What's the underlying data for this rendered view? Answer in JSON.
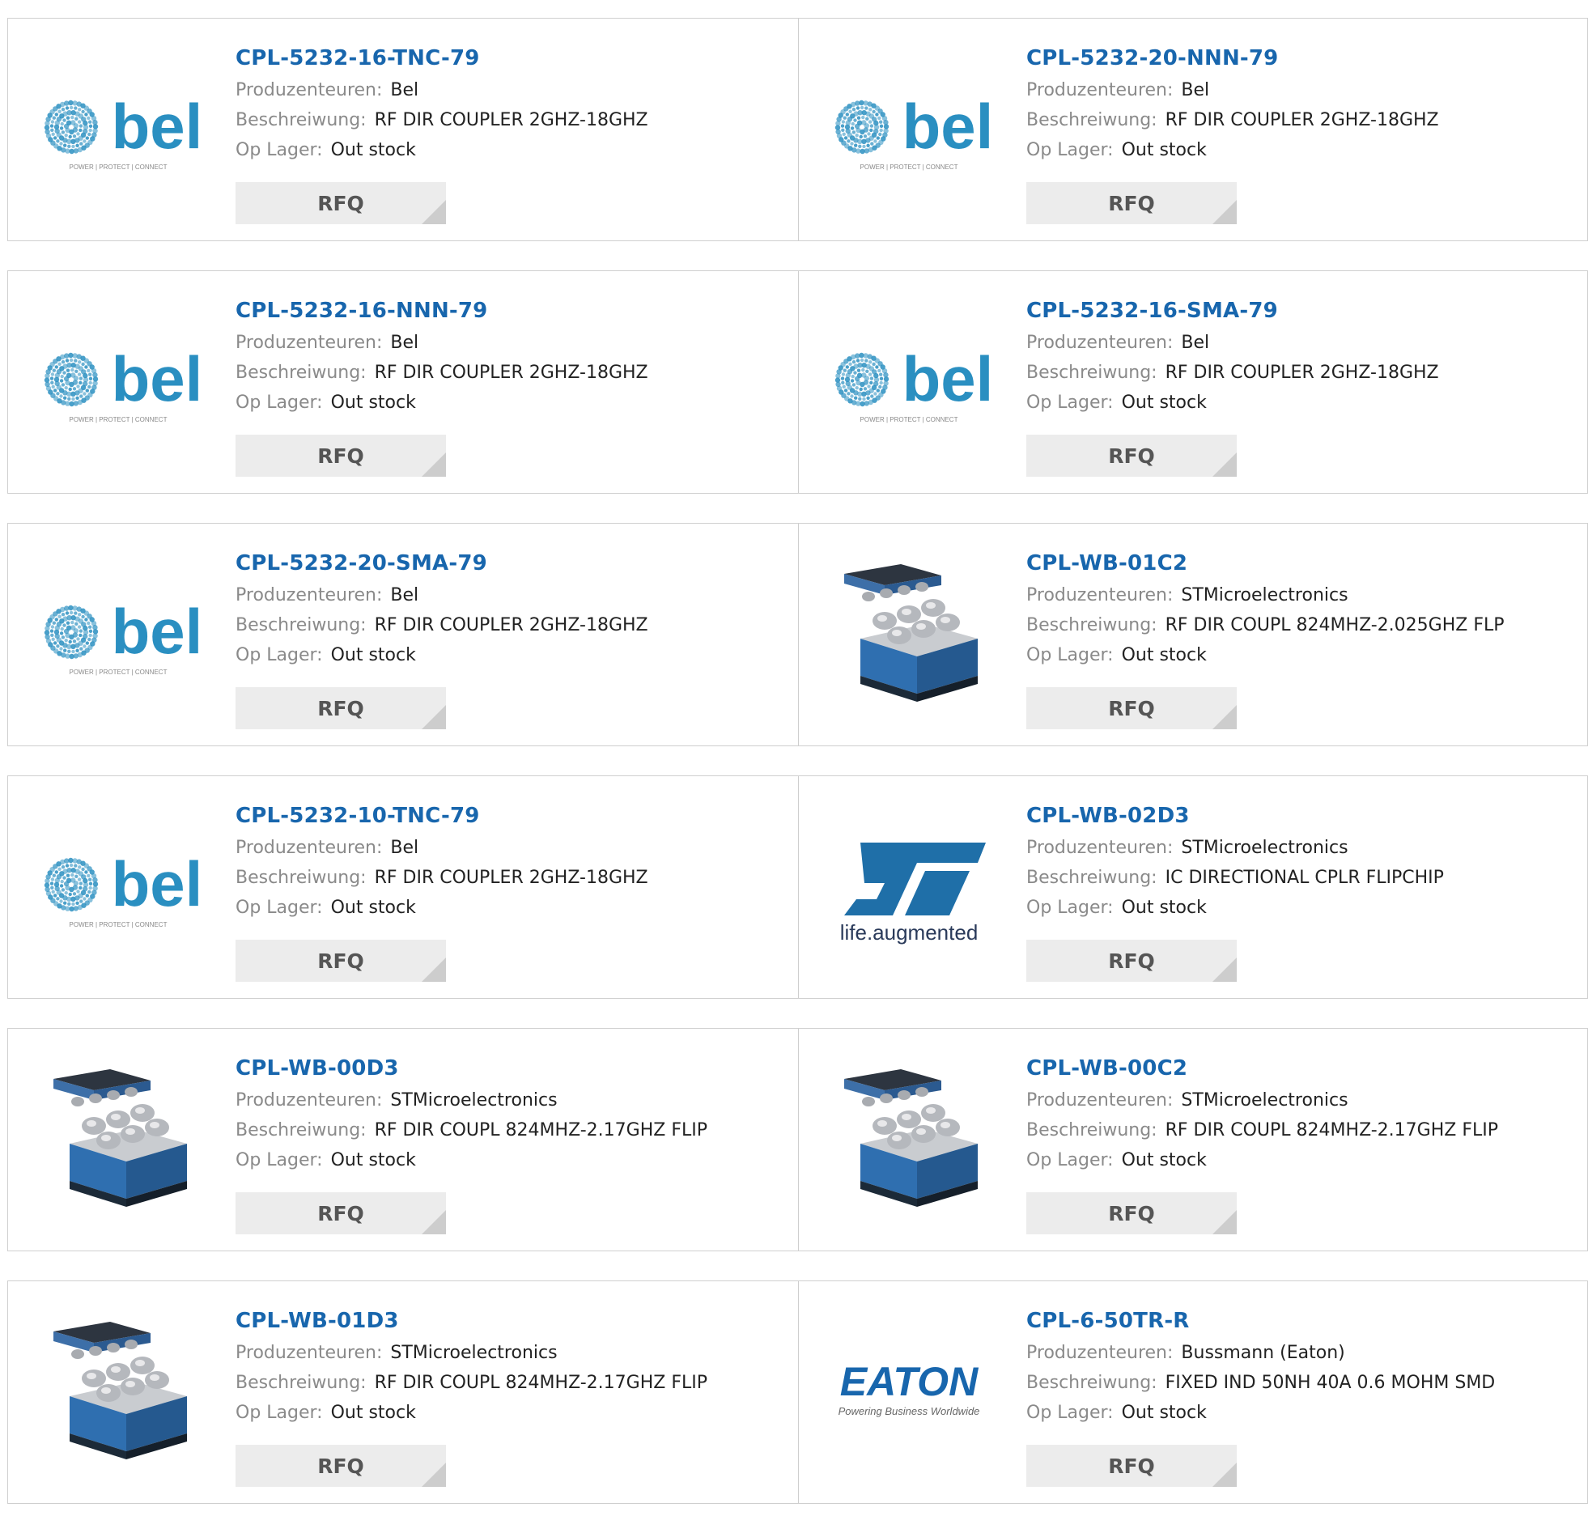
{
  "labels": {
    "manufacturer": "Produzenteuren:",
    "description": "Beschreiwung:",
    "stock": "Op Lager:",
    "rfq": "RFQ"
  },
  "logos": {
    "bel": {
      "text": "bel",
      "tagline": "POWER | PROTECT | CONNECT",
      "color": "#2a8fc1"
    },
    "st": {
      "tagline": "life.augmented",
      "color": "#1f6fa8"
    },
    "eaton": {
      "text": "EATON",
      "tagline": "Powering Business Worldwide",
      "color": "#1866ad"
    }
  },
  "products": [
    {
      "part": "CPL-5232-16-TNC-79",
      "manufacturer": "Bel",
      "description": "RF DIR COUPLER 2GHZ-18GHZ",
      "stock": "Out stock",
      "logo": "bel"
    },
    {
      "part": "CPL-5232-20-NNN-79",
      "manufacturer": "Bel",
      "description": "RF DIR COUPLER 2GHZ-18GHZ",
      "stock": "Out stock",
      "logo": "bel"
    },
    {
      "part": "CPL-5232-16-NNN-79",
      "manufacturer": "Bel",
      "description": "RF DIR COUPLER 2GHZ-18GHZ",
      "stock": "Out stock",
      "logo": "bel"
    },
    {
      "part": "CPL-5232-16-SMA-79",
      "manufacturer": "Bel",
      "description": "RF DIR COUPLER 2GHZ-18GHZ",
      "stock": "Out stock",
      "logo": "bel"
    },
    {
      "part": "CPL-5232-20-SMA-79",
      "manufacturer": "Bel",
      "description": "RF DIR COUPLER 2GHZ-18GHZ",
      "stock": "Out stock",
      "logo": "bel"
    },
    {
      "part": "CPL-WB-01C2",
      "manufacturer": "STMicroelectronics",
      "description": "RF DIR COUPL 824MHZ-2.025GHZ FLP",
      "stock": "Out stock",
      "logo": "chip"
    },
    {
      "part": "CPL-5232-10-TNC-79",
      "manufacturer": "Bel",
      "description": "RF DIR COUPLER 2GHZ-18GHZ",
      "stock": "Out stock",
      "logo": "bel"
    },
    {
      "part": "CPL-WB-02D3",
      "manufacturer": "STMicroelectronics",
      "description": "IC DIRECTIONAL CPLR FLIPCHIP",
      "stock": "Out stock",
      "logo": "st"
    },
    {
      "part": "CPL-WB-00D3",
      "manufacturer": "STMicroelectronics",
      "description": "RF DIR COUPL 824MHZ-2.17GHZ FLIP",
      "stock": "Out stock",
      "logo": "chip"
    },
    {
      "part": "CPL-WB-00C2",
      "manufacturer": "STMicroelectronics",
      "description": "RF DIR COUPL 824MHZ-2.17GHZ FLIP",
      "stock": "Out stock",
      "logo": "chip"
    },
    {
      "part": "CPL-WB-01D3",
      "manufacturer": "STMicroelectronics",
      "description": "RF DIR COUPL 824MHZ-2.17GHZ FLIP",
      "stock": "Out stock",
      "logo": "chip"
    },
    {
      "part": "CPL-6-50TR-R",
      "manufacturer": "Bussmann (Eaton)",
      "description": "FIXED IND 50NH 40A 0.6 MOHM SMD",
      "stock": "Out stock",
      "logo": "eaton"
    }
  ]
}
